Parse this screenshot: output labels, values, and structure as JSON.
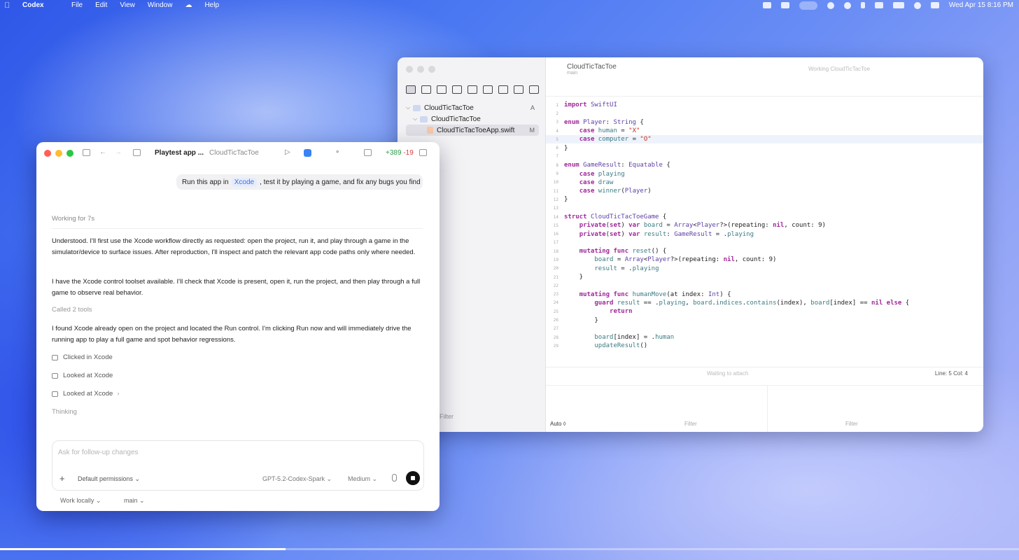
{
  "menubar": {
    "app_name": "Codex",
    "menus": [
      "File",
      "Edit",
      "View",
      "Window",
      "Help"
    ],
    "clock": "Wed Apr 15  8:16 PM"
  },
  "xcode": {
    "project_title": "CloudTicTacToe",
    "project_subtitle": "main",
    "status_text": "Working CloudTicTacToe",
    "tree": [
      {
        "label": "CloudTicTacToe",
        "badge": "A"
      },
      {
        "label": "CloudTicTacToe",
        "badge": ""
      },
      {
        "label": "CloudTicTacToeApp.swift",
        "badge": "M"
      }
    ],
    "sidebar_filter": "Filter",
    "code_lines": [
      "import SwiftUI",
      "",
      "enum Player: String {",
      "    case human = \"X\"",
      "    case computer = \"O\"",
      "}",
      "",
      "enum GameResult: Equatable {",
      "    case playing",
      "    case draw",
      "    case winner(Player)",
      "}",
      "",
      "struct CloudTicTacToeGame {",
      "    private(set) var board = Array<Player?>(repeating: nil, count: 9)",
      "    private(set) var result: GameResult = .playing",
      "",
      "    mutating func reset() {",
      "        board = Array<Player?>(repeating: nil, count: 9)",
      "        result = .playing",
      "    }",
      "",
      "    mutating func humanMove(at index: Int) {",
      "        guard result == .playing, board.indices.contains(index), board[index] == nil else {",
      "            return",
      "        }",
      "",
      "        board[index] = .human",
      "        updateResult()"
    ],
    "highlight_line": 5,
    "debug_status": "Waiting to attach",
    "line_col": "Line: 5  Col: 4",
    "auto_label": "Auto ◊",
    "filter_left": "Filter",
    "filter_right": "Filter"
  },
  "codex": {
    "thread_title": "Playtest app ...",
    "project": "CloudTicTacToe",
    "diff_add": "+389",
    "diff_del": "-19",
    "user_message_pre": "Run this app in",
    "user_message_mention": "Xcode",
    "user_message_post": ", test it by playing a game, and fix any bugs you find",
    "working": "Working for 7s",
    "para1": "Understood. I'll first use the Xcode workflow directly as requested: open the project, run it, and play through a game in the simulator/device to surface issues. After reproduction, I'll inspect and patch the relevant app code paths only where needed.",
    "para2": "I have the Xcode control toolset available. I'll check that Xcode is present, open it, run the project, and then play through a full game to observe real behavior.",
    "called_tools": "Called 2 tools",
    "para3": "I found Xcode already open on the project and located the Run control. I'm clicking Run now and will immediately drive the running app to play a full game and spot behavior regressions.",
    "tool_rows": [
      "Clicked in Xcode",
      "Looked at Xcode",
      "Looked at Xcode"
    ],
    "thinking": "Thinking",
    "composer_placeholder": "Ask for follow-up changes",
    "permissions": "Default permissions ⌄",
    "model": "GPT-5.2-Codex-Spark ⌄",
    "effort": "Medium ⌄",
    "work_mode": "Work locally ⌄",
    "branch": "main ⌄"
  },
  "video_progress": 0.28
}
